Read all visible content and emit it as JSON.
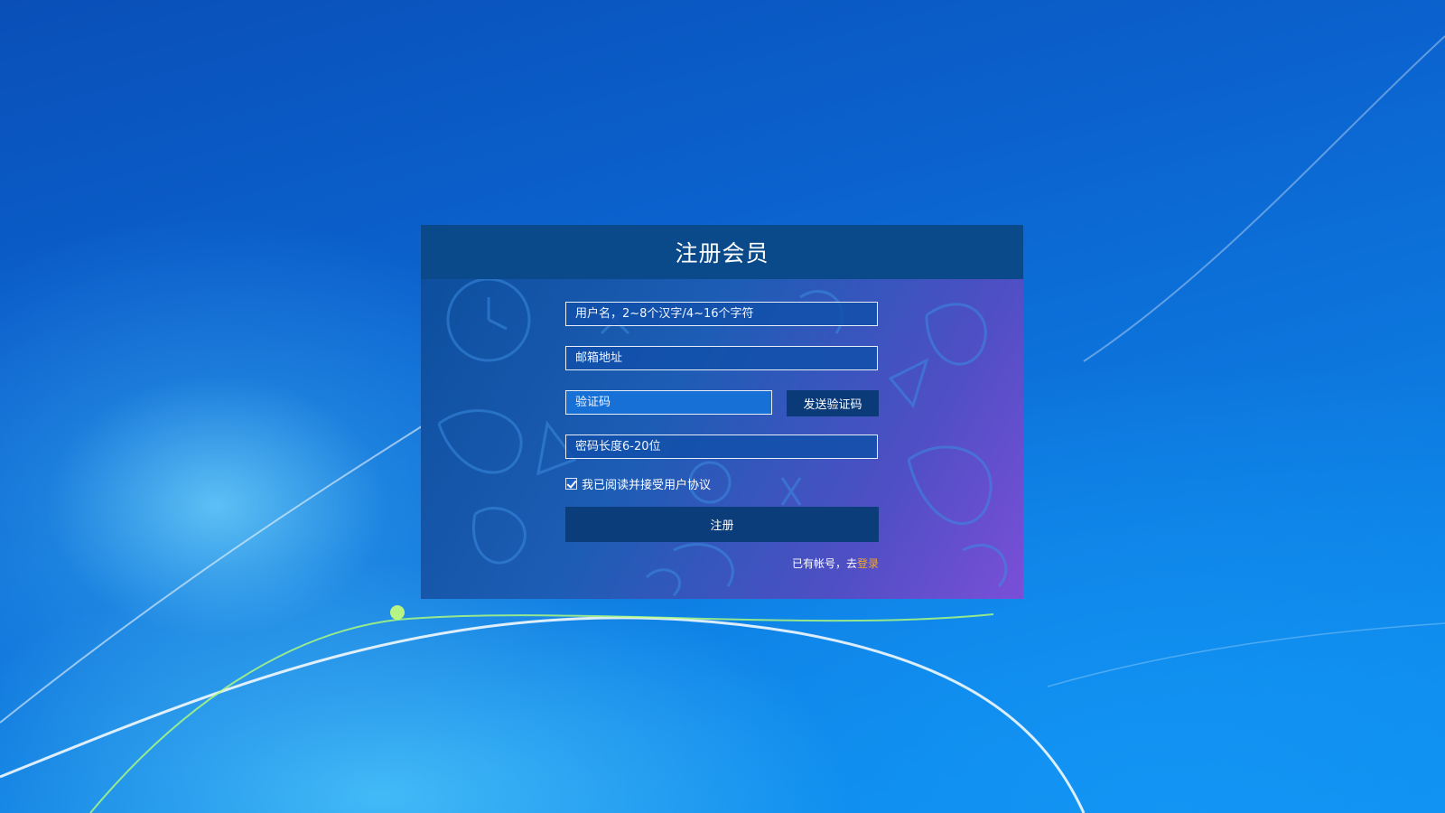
{
  "dialog": {
    "title": "注册会员",
    "username": {
      "placeholder": "用户名，2~8个汉字/4~16个字符",
      "value": ""
    },
    "email": {
      "placeholder": "邮箱地址",
      "value": ""
    },
    "code": {
      "placeholder": "验证码",
      "value": ""
    },
    "send_code_label": "发送验证码",
    "password": {
      "placeholder": "密码长度6-20位",
      "value": ""
    },
    "agree_label": "我已阅读并接受用户协议",
    "agree_checked": true,
    "register_label": "注册",
    "have_account_text": "已有帐号，去",
    "login_label": "登录"
  },
  "colors": {
    "header_bg": "#0a4a8a",
    "button_bg": "#0b3d7a",
    "login_link": "#f6a623"
  }
}
